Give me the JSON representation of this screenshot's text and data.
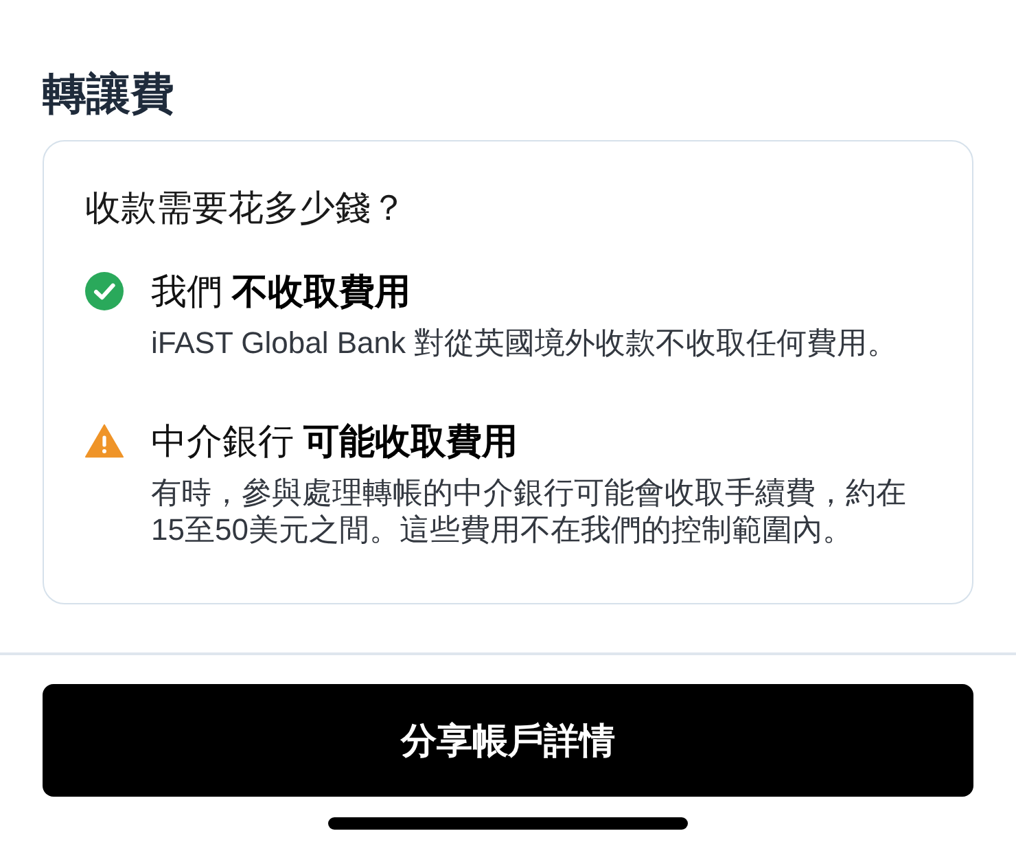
{
  "title": "轉讓費",
  "card": {
    "question": "收款需要花多少錢？",
    "items": [
      {
        "kind": "success",
        "headline": "我們 **不收取費用**",
        "description": "iFAST Global Bank 對從英國境外收款不收取任何費用。"
      },
      {
        "kind": "warning",
        "headline": "中介銀行 **可能收取費用**",
        "description": "有時，參與處理轉帳的中介銀行可能會收取手續費，約在15至50美元之間。這些費用不在我們的控制範圍內。"
      }
    ]
  },
  "button": {
    "label": "分享帳戶詳情"
  }
}
